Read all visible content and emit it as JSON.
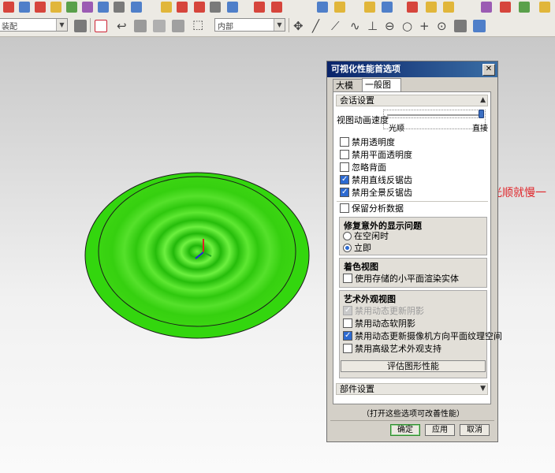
{
  "toolbar2": {
    "selection_filter": "装配",
    "scope": "内部"
  },
  "annotation": {
    "text": "快慢来这里调，光顺就慢一点，直接就快。",
    "color": "#e0262b"
  },
  "model": {
    "disc_color": "#33d60e",
    "outline_color": "#1a1a1a"
  },
  "dialog": {
    "title": "可视化性能首选项",
    "tabs": [
      {
        "label": "大模型",
        "active": false
      },
      {
        "label": "一般图形",
        "active": true
      }
    ],
    "session": {
      "header": "会话设置",
      "view_anim_label": "视图动画速度",
      "slider_min_label": "光顺",
      "slider_max_label": "直接",
      "slider_value": 1.0,
      "checkboxes": [
        {
          "label": "禁用透明度",
          "checked": false
        },
        {
          "label": "禁用平面透明度",
          "checked": false
        },
        {
          "label": "忽略背面",
          "checked": false
        },
        {
          "label": "禁用直线反锯齿",
          "checked": true
        },
        {
          "label": "禁用全景反锯齿",
          "checked": true
        }
      ],
      "retain_label": "保留分析数据",
      "retain_checked": false
    },
    "fix": {
      "title": "修复意外的显示问题",
      "options": [
        {
          "label": "在空闲时",
          "selected": false
        },
        {
          "label": "立即",
          "selected": true
        }
      ]
    },
    "shading": {
      "title": "着色视图",
      "option": {
        "label": "使用存储的小平面渲染实体",
        "checked": false
      }
    },
    "artistic": {
      "title": "艺术外观视图",
      "options": [
        {
          "label": "禁用动态更新阴影",
          "checked": true,
          "disabled": true
        },
        {
          "label": "禁用动态软阴影",
          "checked": false,
          "disabled": false
        },
        {
          "label": "禁用动态更新摄像机方向平面纹理空间",
          "checked": true,
          "disabled": false
        },
        {
          "label": "禁用高级艺术外观支持",
          "checked": false,
          "disabled": false
        }
      ]
    },
    "eval_button": "评估图形性能",
    "parts_header": "部件设置",
    "hint": "（打开这些选项可改善性能）",
    "buttons": {
      "ok": "确定",
      "apply": "应用",
      "cancel": "取消"
    }
  }
}
